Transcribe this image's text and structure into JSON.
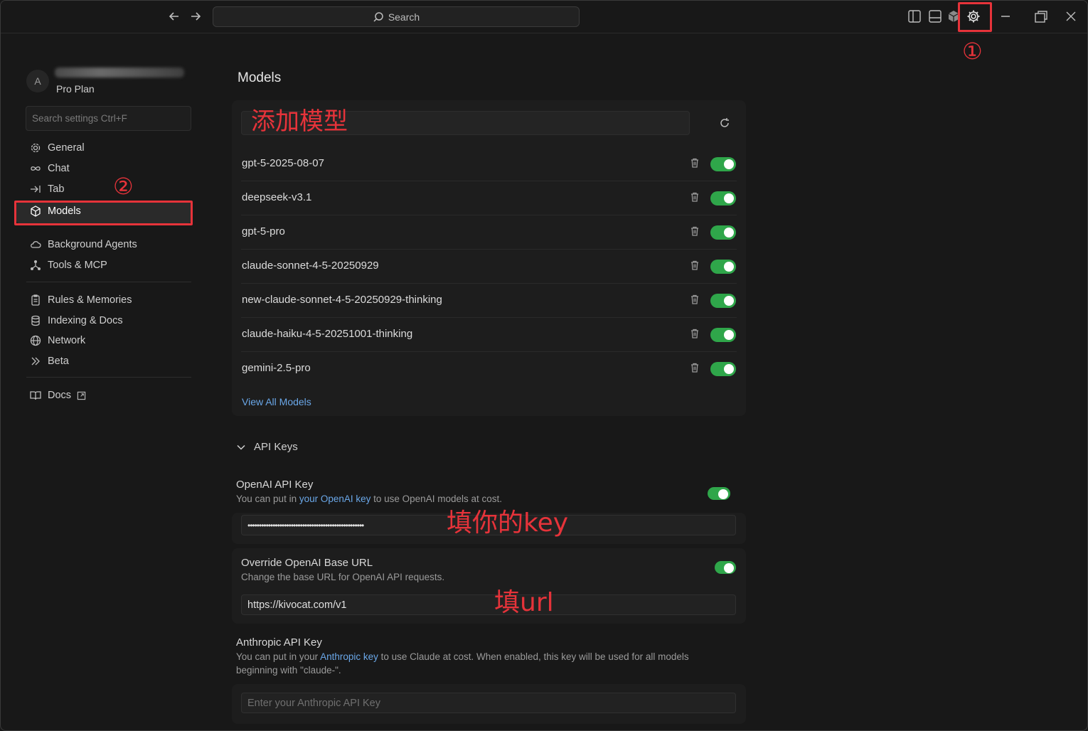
{
  "titlebar": {
    "search_label": "Search"
  },
  "annotations": {
    "step1": "①",
    "step2": "②",
    "add_model": "添加模型",
    "fill_key": "填你的key",
    "fill_url": "填url"
  },
  "sidebar": {
    "avatar_initial": "A",
    "plan": "Pro Plan",
    "search_placeholder": "Search settings Ctrl+F",
    "items": [
      {
        "label": "General"
      },
      {
        "label": "Chat"
      },
      {
        "label": "Tab"
      },
      {
        "label": "Models"
      },
      {
        "label": "Background Agents"
      },
      {
        "label": "Tools & MCP"
      },
      {
        "label": "Rules & Memories"
      },
      {
        "label": "Indexing & Docs"
      },
      {
        "label": "Network"
      },
      {
        "label": "Beta"
      },
      {
        "label": "Docs"
      }
    ]
  },
  "main": {
    "title": "Models",
    "models": [
      {
        "name": "gpt-5-2025-08-07",
        "enabled": true
      },
      {
        "name": "deepseek-v3.1",
        "enabled": true
      },
      {
        "name": "gpt-5-pro",
        "enabled": true
      },
      {
        "name": "claude-sonnet-4-5-20250929",
        "enabled": true
      },
      {
        "name": "new-claude-sonnet-4-5-20250929-thinking",
        "enabled": true
      },
      {
        "name": "claude-haiku-4-5-20251001-thinking",
        "enabled": true
      },
      {
        "name": "gemini-2.5-pro",
        "enabled": true
      }
    ],
    "view_all": "View All Models",
    "api_keys_label": "API Keys",
    "openai": {
      "title": "OpenAI API Key",
      "desc_pre": "You can put in ",
      "desc_link": "your OpenAI key",
      "desc_post": " to use OpenAI models at cost.",
      "value": "•••••••••••••••••••••••••••••••••••••••••••••••••••",
      "enabled": true
    },
    "override": {
      "title": "Override OpenAI Base URL",
      "desc": "Change the base URL for OpenAI API requests.",
      "value": "https://kivocat.com/v1",
      "enabled": true
    },
    "anthropic": {
      "title": "Anthropic API Key",
      "desc_pre": "You can put in your ",
      "desc_link": "Anthropic key",
      "desc_post": " to use Claude at cost. When enabled, this key will be used for all models beginning with \"claude-\".",
      "placeholder": "Enter your Anthropic API Key"
    }
  },
  "colors": {
    "accent_toggle": "#2fa64a",
    "annotation_red": "#e6333a",
    "link": "#6aa7e8"
  }
}
